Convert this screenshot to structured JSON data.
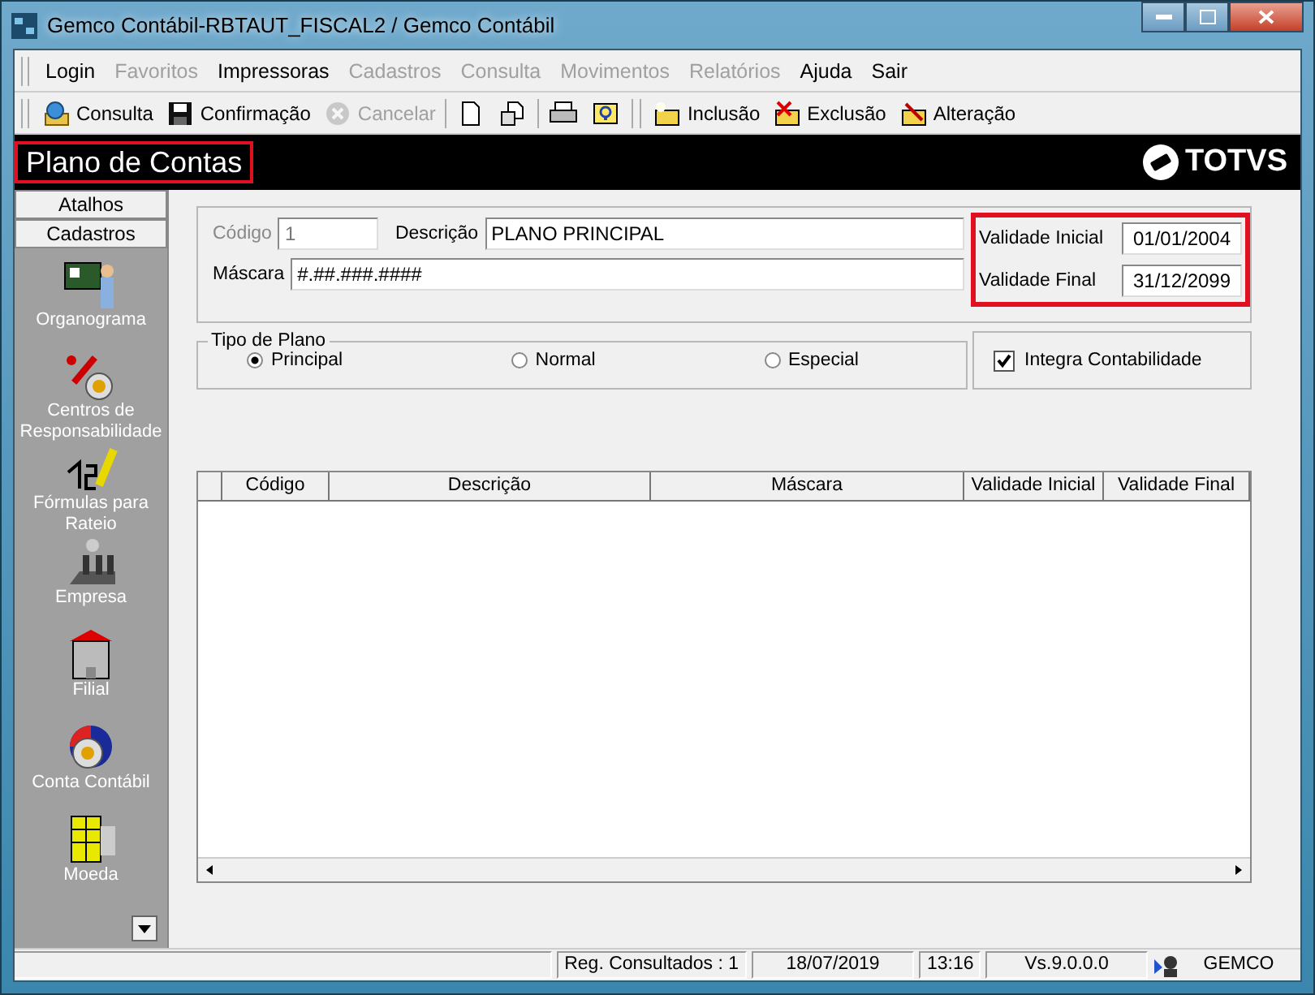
{
  "window": {
    "title": "Gemco Contábil-RBTAUT_FISCAL2 / Gemco Contábil"
  },
  "menu": [
    {
      "label": "Login",
      "disabled": false
    },
    {
      "label": "Favoritos",
      "disabled": true
    },
    {
      "label": "Impressoras",
      "disabled": false
    },
    {
      "label": "Cadastros",
      "disabled": true
    },
    {
      "label": "Consulta",
      "disabled": true
    },
    {
      "label": "Movimentos",
      "disabled": true
    },
    {
      "label": "Relatórios",
      "disabled": true
    },
    {
      "label": "Ajuda",
      "disabled": false
    },
    {
      "label": "Sair",
      "disabled": false
    }
  ],
  "toolbar": [
    {
      "kind": "consulta",
      "label": "Consulta",
      "disabled": false
    },
    {
      "kind": "save",
      "label": "Confirmação",
      "disabled": false
    },
    {
      "kind": "cancel",
      "label": "Cancelar",
      "disabled": true
    },
    {
      "kind": "new",
      "disabled": false
    },
    {
      "kind": "open",
      "disabled": false
    },
    {
      "kind": "print",
      "disabled": false
    },
    {
      "kind": "help",
      "disabled": false
    },
    {
      "kind": "insert",
      "label": "Inclusão",
      "disabled": false
    },
    {
      "kind": "delete",
      "label": "Exclusão",
      "disabled": false
    },
    {
      "kind": "edit",
      "label": "Alteração",
      "disabled": false
    }
  ],
  "header": {
    "title": "Plano de Contas",
    "logo": "TOTVS"
  },
  "sidebar": {
    "tabs": [
      "Atalhos",
      "Cadastros"
    ],
    "items": [
      {
        "label": "Organograma"
      },
      {
        "label": "Centros de Responsabilidade"
      },
      {
        "label": "Fórmulas para Rateio"
      },
      {
        "label": "Empresa"
      },
      {
        "label": "Filial"
      },
      {
        "label": "Conta Contábil"
      },
      {
        "label": "Moeda"
      }
    ]
  },
  "form": {
    "codigo": {
      "label": "Código",
      "value": "1",
      "disabled": true
    },
    "descricao": {
      "label": "Descrição",
      "value": "PLANO PRINCIPAL"
    },
    "mascara": {
      "label": "Máscara",
      "value": "#.##.###.####"
    },
    "validade_inicial": {
      "label": "Validade Inicial",
      "value": "01/01/2004"
    },
    "validade_final": {
      "label": "Validade Final",
      "value": "31/12/2099"
    },
    "tipo_de_plano": {
      "label": "Tipo de Plano",
      "options": [
        {
          "label": "Principal",
          "selected": true
        },
        {
          "label": "Normal",
          "selected": false
        },
        {
          "label": "Especial",
          "selected": false
        }
      ]
    },
    "integra_contabilidade": {
      "label": "Integra Contabilidade",
      "checked": true
    }
  },
  "table": {
    "columns": [
      "Código",
      "Descrição",
      "Máscara",
      "Validade Inicial",
      "Validade Final"
    ]
  },
  "status_bar": {
    "registros": "Reg. Consultados : 1",
    "date": "18/07/2019",
    "time": "13:16",
    "version": "Vs.9.0.0.0",
    "user": "GEMCO"
  }
}
